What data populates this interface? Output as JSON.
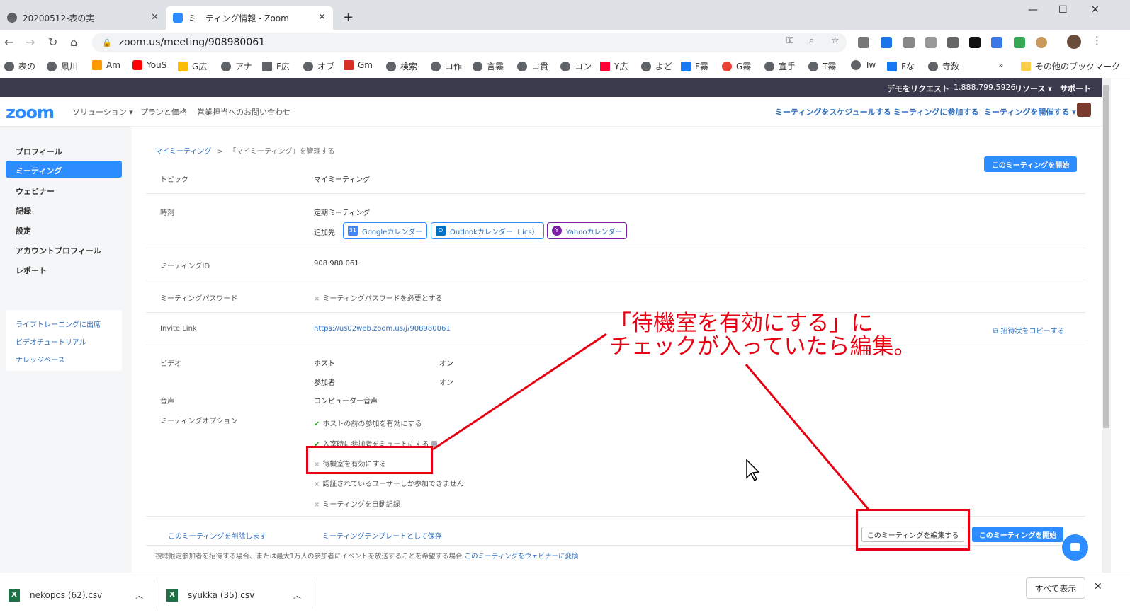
{
  "browser": {
    "tabs": [
      {
        "title": "20200512-表の実"
      },
      {
        "title": "ミーティング情報 - Zoom"
      }
    ],
    "new_tab": "+",
    "url": "zoom.us/meeting/908980061",
    "window_controls": {
      "min": "—",
      "max": "☐",
      "close": "✕"
    },
    "bookmarks": [
      "表の",
      "凧川",
      "Am",
      "YouS",
      "G広",
      "アナ",
      "F広",
      "オブ",
      "Gm",
      "検索",
      "コ作",
      "言霧",
      "コ貴",
      "コン",
      "Y広",
      "よど",
      "F霧",
      "G霧",
      "宣手",
      "T霧",
      "Tw",
      "Fな",
      "寺数"
    ],
    "bookmarks_overflow": "»",
    "other_bookmarks": "その他のブックマーク"
  },
  "zoom": {
    "topstrip": {
      "demo": "デモをリクエスト",
      "phone": "1.888.799.5926",
      "resources": "リソース ▾",
      "support": "サポート"
    },
    "logo": "zoom",
    "nav": {
      "solutions": "ソリューション ▾",
      "plans": "プランと価格",
      "contact": "営業担当へのお問い合わせ"
    },
    "nav_right": {
      "schedule": "ミーティングをスケジュールする",
      "join": "ミーティングに参加する",
      "host": "ミーティングを開催する ▾"
    },
    "sidebar": {
      "items": [
        "プロフィール",
        "ミーティング",
        "ウェビナー",
        "記録",
        "設定",
        "アカウントプロフィール",
        "レポート"
      ],
      "links": [
        "ライブトレーニングに出席",
        "ビデオチュートリアル",
        "ナレッジベース"
      ]
    },
    "breadcrumb": {
      "parent": "マイミーティング",
      "sep": ">",
      "current": "「マイミーティング」を管理する"
    },
    "start_button": "このミーティングを開始",
    "topic": {
      "label": "トピック",
      "value": "マイミーティング"
    },
    "time": {
      "label": "時刻",
      "value": "定期ミーティング",
      "add_to": "追加先"
    },
    "calendars": {
      "google": "Googleカレンダー",
      "outlook": "Outlookカレンダー（.ics）",
      "yahoo": "Yahooカレンダー"
    },
    "meeting_id": {
      "label": "ミーティングID",
      "value": "908 980 061"
    },
    "password": {
      "label": "ミーティングパスワード",
      "value": "ミーティングパスワードを必要とする"
    },
    "invite": {
      "label": "Invite Link",
      "value": "https://us02web.zoom.us/j/908980061",
      "copy": "招待状をコピーする"
    },
    "video": {
      "label": "ビデオ",
      "host": "ホスト",
      "host_val": "オン",
      "participant": "参加者",
      "participant_val": "オン"
    },
    "audio": {
      "label": "音声",
      "value": "コンピューター音声"
    },
    "options": {
      "label": "ミーティングオプション",
      "items": [
        "ホストの前の参加を有効にする",
        "入室時に参加者をミュートにする",
        "待機室を有効にする",
        "認証されているユーザーしか参加できません",
        "ミーティングを自動記録"
      ]
    },
    "actions": {
      "delete": "このミーティングを削除します",
      "template": "ミーティングテンプレートとして保存",
      "edit": "このミーティングを編集する",
      "start": "このミーティングを開始"
    },
    "footer_note": "視聴限定参加者を招待する場合、または最大1万人の参加者にイベントを放送することを希望する場合",
    "footer_link": "このミーティングをウェビナーに変換"
  },
  "annotation": {
    "line1": "「待機室を有効にする」に",
    "line2": "チェックが入っていたら編集。"
  },
  "downloads": {
    "files": [
      "nekopos (62).csv",
      "syukka (35).csv"
    ],
    "show_all": "すべて表示"
  },
  "colors": {
    "zoom_blue": "#2d8cff",
    "annotation_red": "#e60012",
    "top_strip": "#3a3a4c"
  }
}
